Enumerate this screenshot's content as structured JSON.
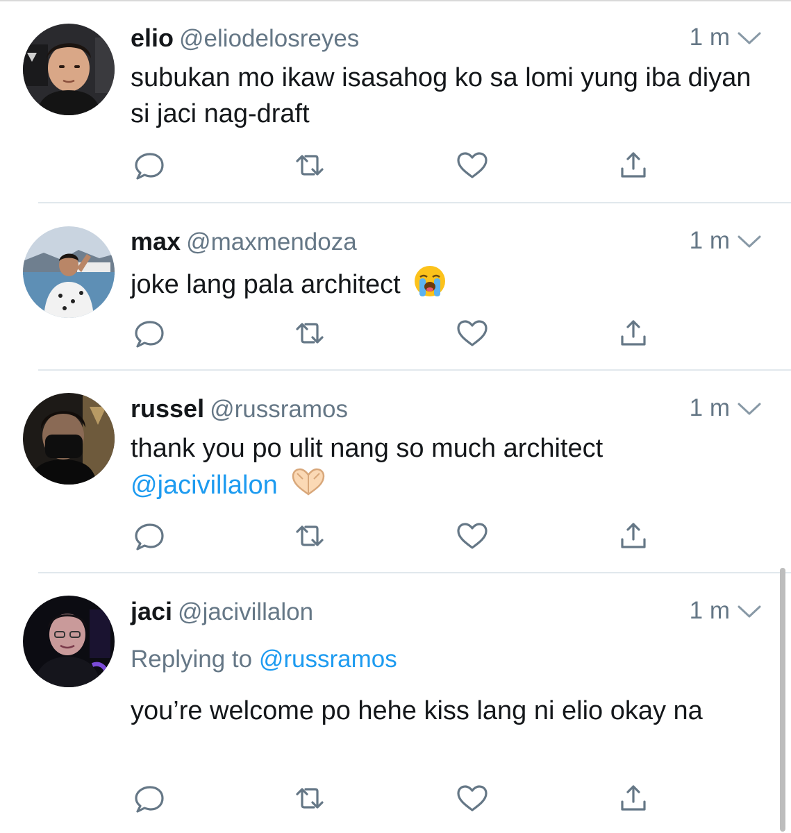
{
  "tweets": [
    {
      "name": "elio",
      "handle": "@eliodelosreyes",
      "time": "1 m",
      "text": "subukan mo ikaw isasahog ko sa lomi yung iba diyan si jaci nag-draft"
    },
    {
      "name": "max",
      "handle": "@maxmendoza",
      "time": "1 m",
      "text": "joke lang pala architect",
      "emoji": "loudly-crying-face-emoji"
    },
    {
      "name": "russel",
      "handle": "@russramos",
      "time": "1 m",
      "text": "thank you po ulit nang so much architect",
      "mention": "@jacivillalon",
      "emoji": "heart-hands-emoji"
    },
    {
      "name": "jaci",
      "handle": "@jacivillalon",
      "time": "1 m",
      "reply_prefix": "Replying to",
      "reply_to": "@russramos",
      "text": "you’re welcome po hehe kiss lang ni elio okay na"
    }
  ],
  "action_icons": [
    "reply-icon",
    "retweet-icon",
    "like-icon",
    "share-icon"
  ],
  "colors": {
    "text": "#14171a",
    "secondary": "#657786",
    "link": "#1d9bf0",
    "icon": "#657786",
    "divider": "#e1e8ed"
  }
}
